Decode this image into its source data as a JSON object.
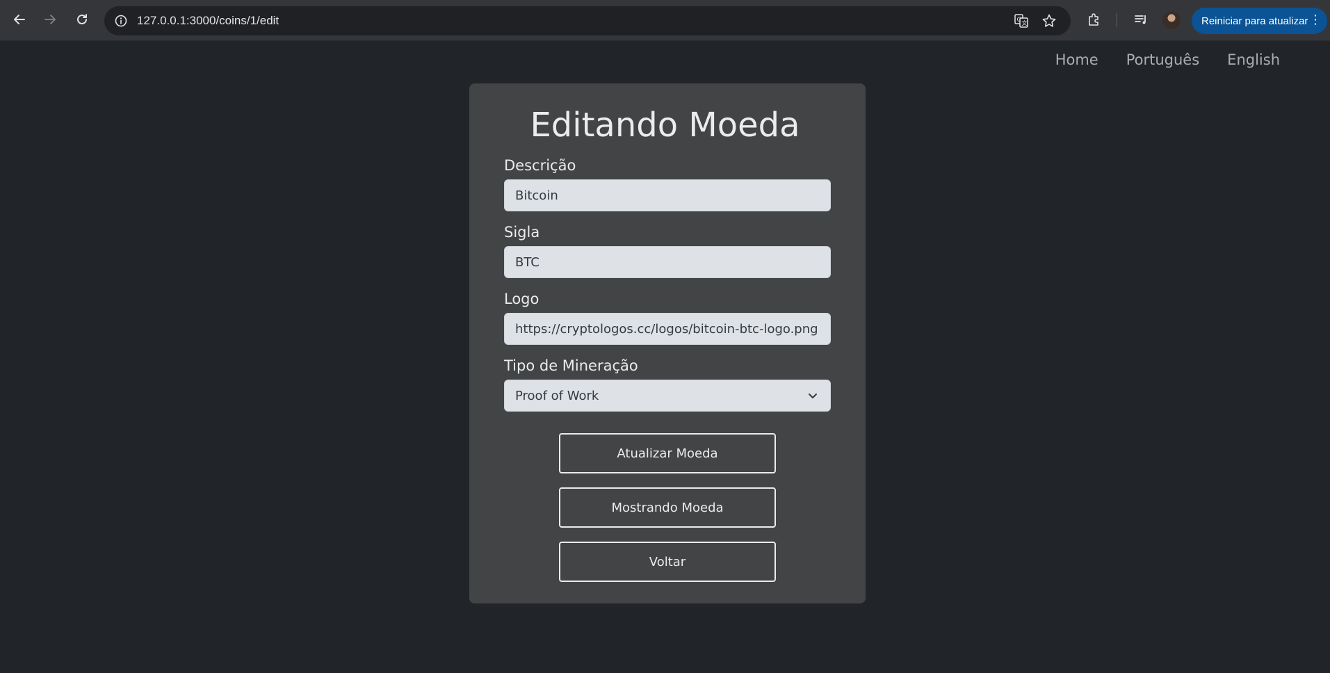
{
  "browser": {
    "url": "127.0.0.1:3000/coins/1/edit",
    "update_button_label": "Reiniciar para atualizar",
    "icons": [
      "back-icon",
      "forward-icon",
      "reload-icon",
      "site-info-icon",
      "translate-icon",
      "bookmark-star-icon",
      "extensions-icon",
      "media-controls-icon",
      "profile-avatar",
      "more-menu-icon"
    ],
    "accent_color": "#0b5394"
  },
  "nav": {
    "home": "Home",
    "portuguese": "Português",
    "english": "English"
  },
  "form": {
    "title": "Editando Moeda",
    "description_label": "Descrição",
    "description_value": "Bitcoin",
    "symbol_label": "Sigla",
    "symbol_value": "BTC",
    "logo_label": "Logo",
    "logo_value": "https://cryptologos.cc/logos/bitcoin-btc-logo.png",
    "mining_type_label": "Tipo de Mineração",
    "mining_type_selected": "Proof of Work",
    "submit_label": "Atualizar Moeda",
    "show_label": "Mostrando Moeda",
    "back_label": "Voltar"
  },
  "colors": {
    "page_background": "#212529",
    "card_background": "#434446",
    "input_background": "#dee2e6"
  }
}
